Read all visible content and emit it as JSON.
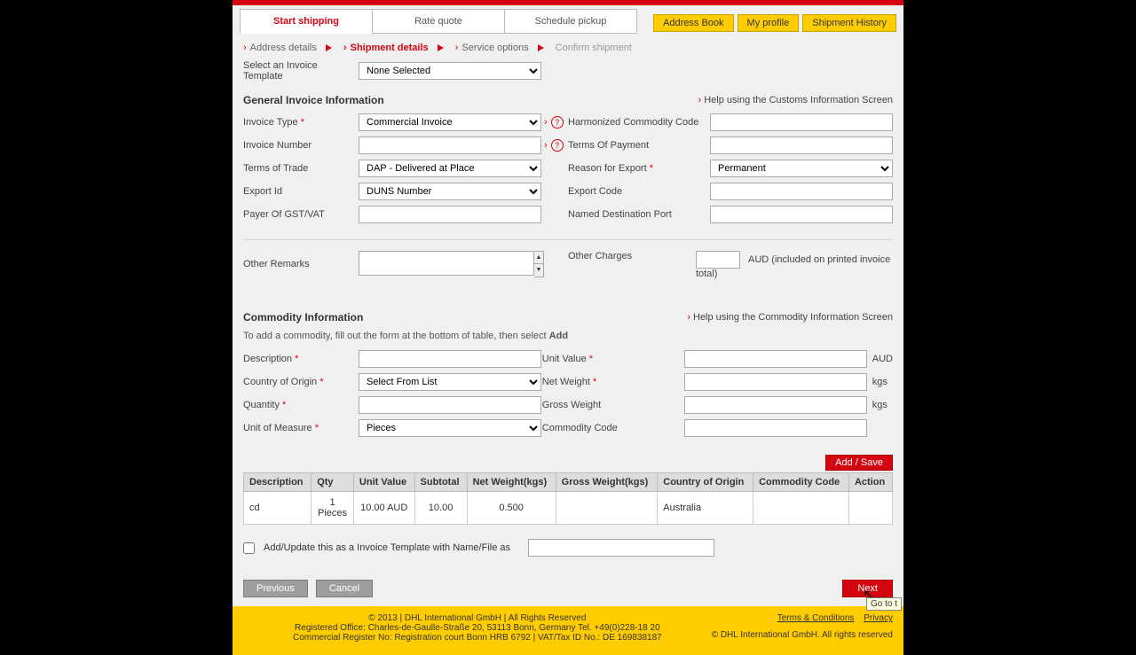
{
  "header": {
    "tabs": [
      "Start shipping",
      "Rate quote",
      "Schedule pickup"
    ],
    "actions": [
      "Address Book",
      "My profile",
      "Shipment History"
    ]
  },
  "crumbs": [
    "Address details",
    "Shipment details",
    "Service options",
    "Confirm shipment"
  ],
  "template": {
    "label": "Select an Invoice Template",
    "value": "None Selected"
  },
  "general": {
    "title": "General Invoice Information",
    "help": "Help using the Customs Information Screen",
    "invoice_type_label": "Invoice Type",
    "invoice_type_value": "Commercial Invoice",
    "invoice_number_label": "Invoice Number",
    "terms_trade_label": "Terms of Trade",
    "terms_trade_value": "DAP - Delivered at Place",
    "export_id_label": "Export Id",
    "export_id_value": "DUNS Number",
    "payer_label": "Payer Of GST/VAT",
    "hcc_label": "Harmonized Commodity Code",
    "top_label": "Terms Of Payment",
    "reason_label": "Reason for Export",
    "reason_value": "Permanent",
    "export_code_label": "Export Code",
    "ndp_label": "Named Destination Port",
    "remarks_label": "Other Remarks",
    "charges_label": "Other Charges",
    "charges_suffix": "AUD  (included on printed invoice total)"
  },
  "commodity": {
    "title": "Commodity Information",
    "help": "Help using the Commodity Information Screen",
    "instr_pre": "To add a commodity, fill out the form at the bottom of table, then select ",
    "instr_bold": "Add",
    "desc_label": "Description",
    "coo_label": "Country of Origin",
    "coo_value": "Select From List",
    "qty_label": "Quantity",
    "uom_label": "Unit of Measure",
    "uom_value": "Pieces",
    "uv_label": "Unit Value",
    "uv_unit": "AUD",
    "nw_label": "Net Weight",
    "nw_unit": "kgs",
    "gw_label": "Gross Weight",
    "gw_unit": "kgs",
    "cc_label": "Commodity Code",
    "add_save": "Add / Save"
  },
  "table": {
    "headers": [
      "Description",
      "Qty",
      "Unit Value",
      "Subtotal",
      "Net Weight(kgs)",
      "Gross Weight(kgs)",
      "Country of Origin",
      "Commodity Code",
      "Action"
    ],
    "rows": [
      {
        "desc": "cd",
        "qty": "1\nPieces",
        "unit_value": "10.00 AUD",
        "subtotal": "10.00",
        "net_weight": "0.500",
        "gross_weight": "",
        "coo": "Australia",
        "cc": "",
        "action": ""
      }
    ]
  },
  "tmpl_checkbox": "Add/Update this as a Invoice Template with Name/File as",
  "nav": {
    "prev": "Previous",
    "cancel": "Cancel",
    "next": "Next",
    "tooltip": "Go to t"
  },
  "footer": {
    "copy": "© 2013 | DHL International GmbH | All Rights Reserved",
    "office": "Registered Office: Charles-de-Gaulle-Straße 20, 53113 Bonn, Germany  Tel. +49(0)228-18 20",
    "register": "Commercial Register No: Registration court Bonn HRB 6792 | VAT/Tax ID No.: DE 169838187",
    "terms": "Terms & Conditions",
    "privacy": "Privacy",
    "copy2": "© DHL International GmbH. All rights reserved"
  }
}
